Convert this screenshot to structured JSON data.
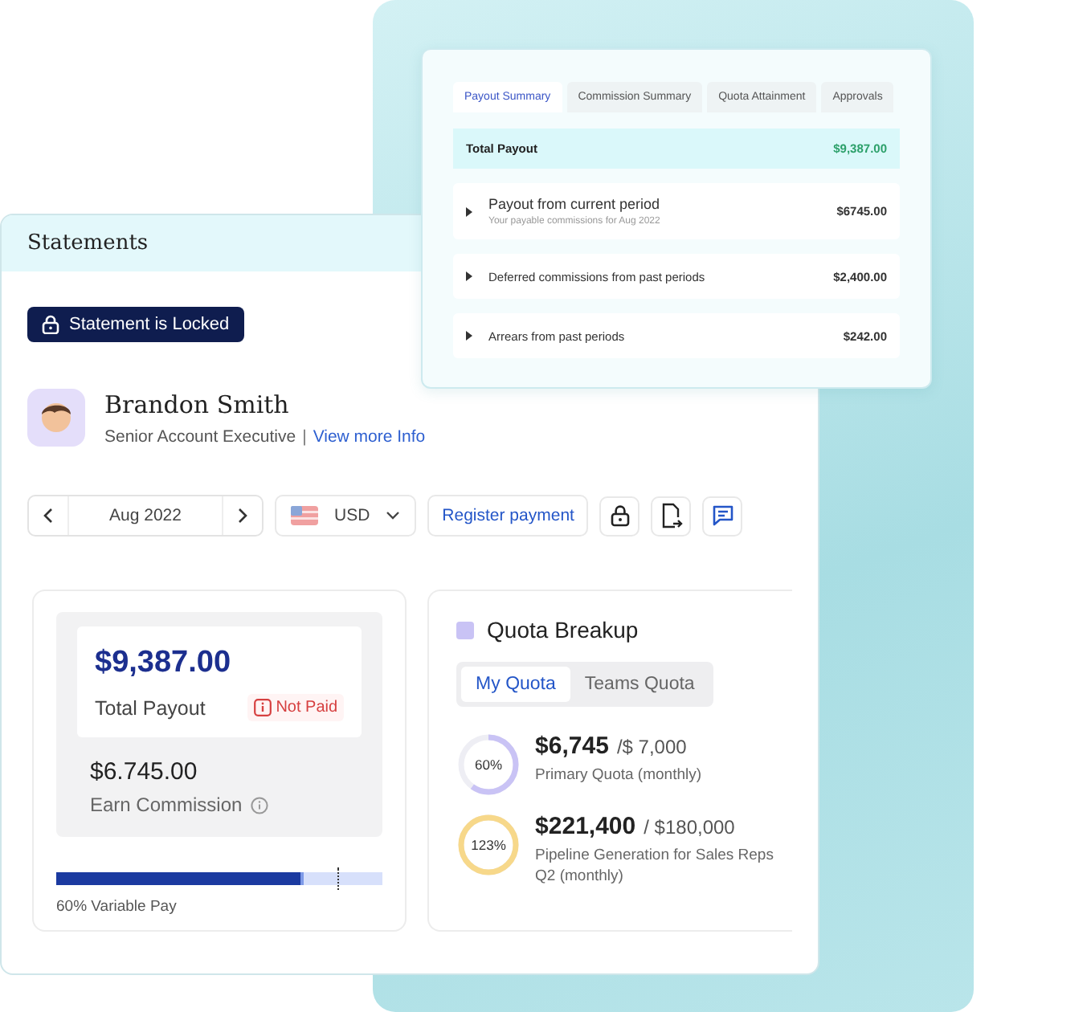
{
  "payout_panel": {
    "tabs": [
      {
        "label": "Payout Summary",
        "selected": true
      },
      {
        "label": "Commission Summary",
        "selected": false
      },
      {
        "label": "Quota Attainment",
        "selected": false
      },
      {
        "label": "Approvals",
        "selected": false
      }
    ],
    "total": {
      "label": "Total Payout",
      "amount": "$9,387.00"
    },
    "rows": [
      {
        "title": "Payout from current period",
        "subtitle": "Your payable commissions for Aug 2022",
        "amount": "$6745.00"
      },
      {
        "title": "Deferred commissions from past periods",
        "amount": "$2,400.00"
      },
      {
        "title": "Arrears from past periods",
        "amount": "$242.00"
      }
    ]
  },
  "statements": {
    "title": "Statements",
    "lock_badge": "Statement is Locked",
    "user": {
      "name": "Brandon Smith",
      "role": "Senior Account Executive",
      "separator": "|",
      "link": "View more Info"
    },
    "toolbar": {
      "period": "Aug 2022",
      "currency": "USD",
      "register_button": "Register payment"
    },
    "payout_card": {
      "amount": "$9,387.00",
      "label": "Total Payout",
      "status": "Not Paid",
      "paid": false,
      "commission": "$6.745.00",
      "commission_label": "Earn Commission",
      "variable_pay": {
        "level": 0.76,
        "label": "60% Variable Pay"
      }
    },
    "quota_card": {
      "title": "Quota Breakup",
      "tabs": [
        {
          "label": "My Quota",
          "selected": true
        },
        {
          "label": "Teams Quota",
          "selected": false
        }
      ],
      "items": [
        {
          "percent": "60%",
          "level": 0.6,
          "color": "#c9c3f5",
          "value": "$6,745",
          "target": "/$ 7,000",
          "label": "Primary Quota (monthly)"
        },
        {
          "percent": "123%",
          "level": 1,
          "color": "#f7d88a",
          "value": "$221,400",
          "target": "/ $180,000",
          "label": "Pipeline Generation for Sales Reps Q2 (monthly)"
        }
      ]
    }
  }
}
